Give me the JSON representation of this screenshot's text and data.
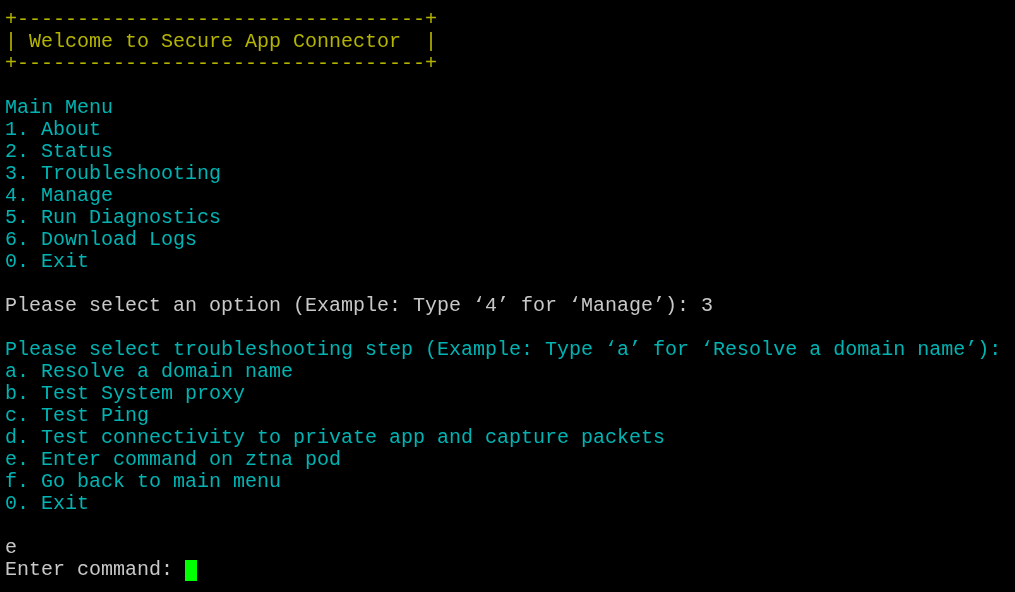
{
  "terminal": {
    "lines": [
      {
        "kind": "border",
        "text": "+----------------------------------+"
      },
      {
        "kind": "title",
        "text": "| Welcome to Secure App Connector  |"
      },
      {
        "kind": "border",
        "text": "+----------------------------------+"
      },
      {
        "kind": "blank"
      },
      {
        "kind": "heading",
        "text": "Main Menu"
      },
      {
        "kind": "item",
        "text": "1. About"
      },
      {
        "kind": "item",
        "text": "2. Status"
      },
      {
        "kind": "item",
        "text": "3. Troubleshooting"
      },
      {
        "kind": "item",
        "text": "4. Manage"
      },
      {
        "kind": "item",
        "text": "5. Run Diagnostics"
      },
      {
        "kind": "item",
        "text": "6. Download Logs"
      },
      {
        "kind": "item",
        "text": "0. Exit"
      },
      {
        "kind": "blank"
      },
      {
        "kind": "prompt",
        "text": "Please select an option (Example: Type ‘4’ for ‘Manage’): 3"
      },
      {
        "kind": "blank"
      },
      {
        "kind": "heading",
        "text": "Please select troubleshooting step (Example: Type ‘a’ for ‘Resolve a domain name’):"
      },
      {
        "kind": "item",
        "text": "a. Resolve a domain name"
      },
      {
        "kind": "item",
        "text": "b. Test System proxy"
      },
      {
        "kind": "item",
        "text": "c. Test Ping"
      },
      {
        "kind": "item",
        "text": "d. Test connectivity to private app and capture packets"
      },
      {
        "kind": "item",
        "text": "e. Enter command on ztna pod"
      },
      {
        "kind": "item",
        "text": "f. Go back to main menu"
      },
      {
        "kind": "item",
        "text": "0. Exit"
      },
      {
        "kind": "blank"
      },
      {
        "kind": "input",
        "text": "e"
      }
    ],
    "command_prompt": {
      "text": "Enter command:"
    }
  }
}
